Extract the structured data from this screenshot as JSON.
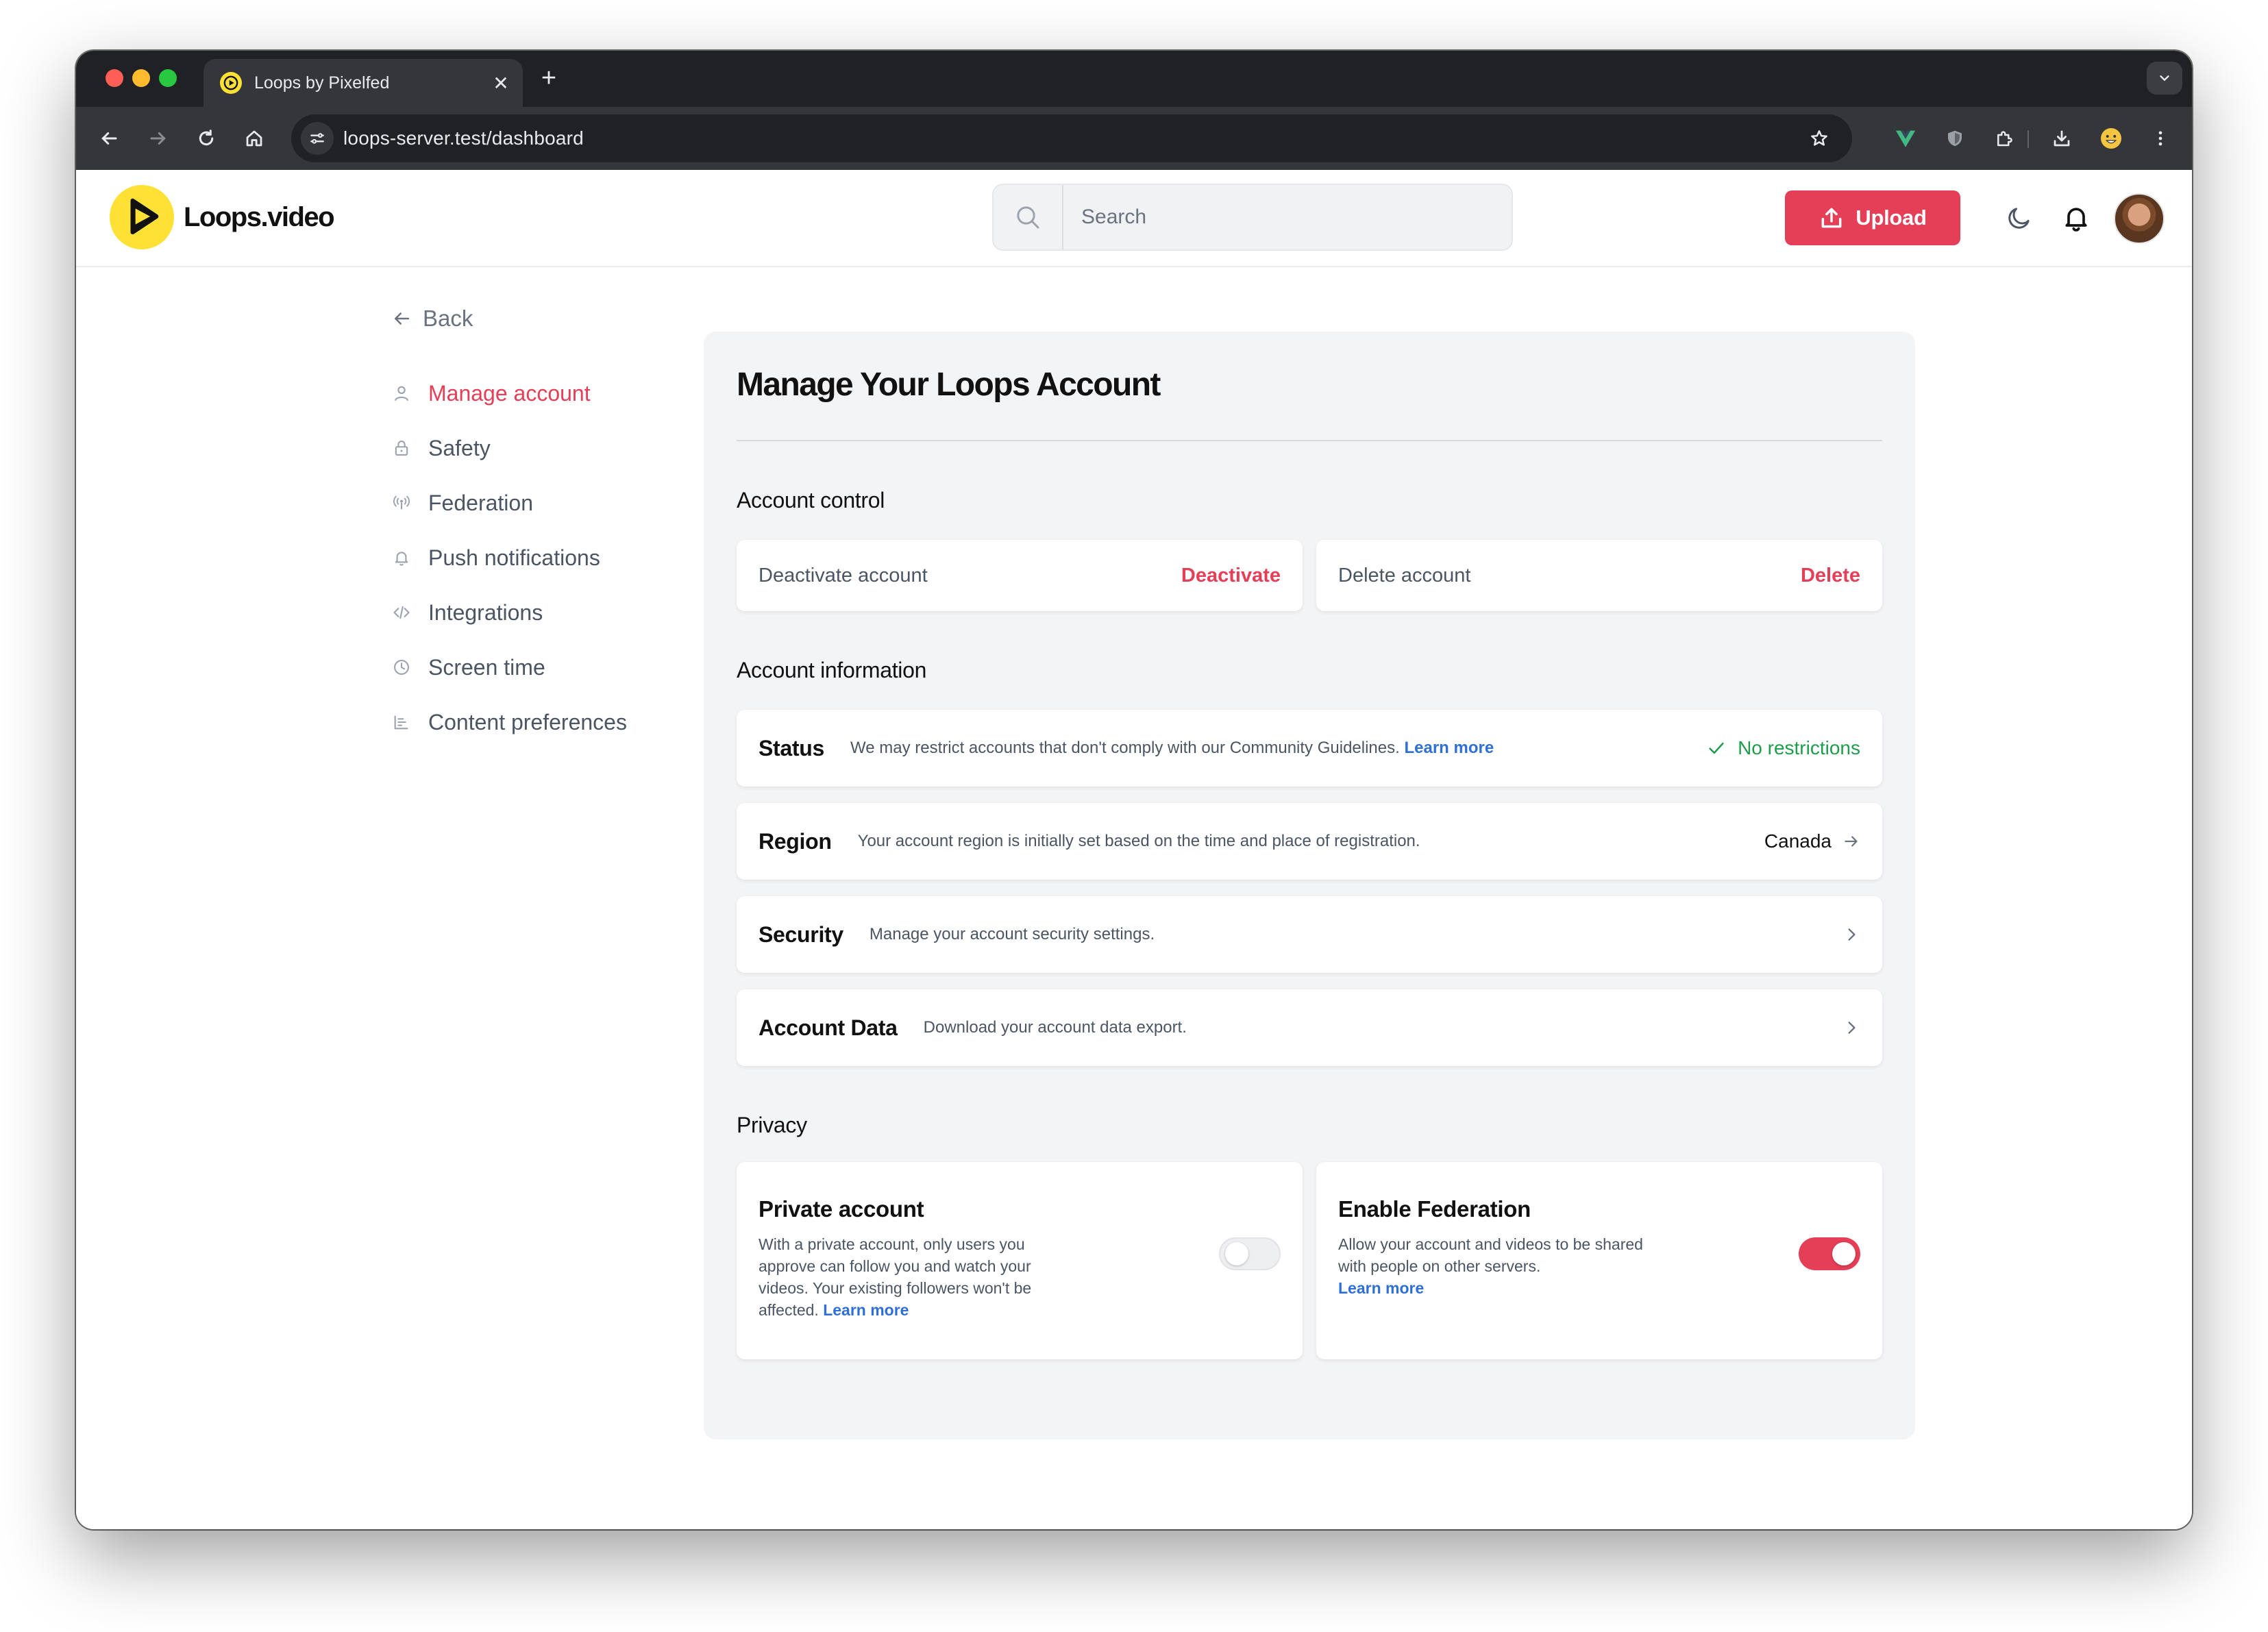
{
  "browser": {
    "tab_title": "Loops by Pixelfed",
    "url": "loops-server.test/dashboard"
  },
  "header": {
    "brand_name": "Loops.video",
    "search_placeholder": "Search",
    "upload_label": "Upload"
  },
  "sidebar": {
    "back_label": "Back",
    "items": [
      {
        "label": "Manage account",
        "icon": "user-icon",
        "active": true
      },
      {
        "label": "Safety",
        "icon": "lock-icon"
      },
      {
        "label": "Federation",
        "icon": "broadcast-icon"
      },
      {
        "label": "Push notifications",
        "icon": "bell-icon"
      },
      {
        "label": "Integrations",
        "icon": "code-icon"
      },
      {
        "label": "Screen time",
        "icon": "clock-icon"
      },
      {
        "label": "Content preferences",
        "icon": "sliders-icon"
      }
    ]
  },
  "main": {
    "title": "Manage Your Loops Account",
    "account_control": {
      "heading": "Account control",
      "deactivate_label": "Deactivate account",
      "deactivate_action": "Deactivate",
      "delete_label": "Delete account",
      "delete_action": "Delete"
    },
    "account_information": {
      "heading": "Account information",
      "status": {
        "name": "Status",
        "desc": "We may restrict accounts that don't comply with our Community Guidelines.",
        "link": "Learn more",
        "value": "No restrictions"
      },
      "region": {
        "name": "Region",
        "desc": "Your account region is initially set based on the time and place of registration.",
        "value": "Canada"
      },
      "security": {
        "name": "Security",
        "desc": "Manage your account security settings."
      },
      "account_data": {
        "name": "Account Data",
        "desc": "Download your account data export."
      }
    },
    "privacy": {
      "heading": "Privacy",
      "private_account": {
        "title": "Private account",
        "desc": "With a private account, only users you approve can follow you and watch your videos. Your existing followers won't be affected.",
        "link": "Learn more",
        "enabled": false
      },
      "federation": {
        "title": "Enable Federation",
        "desc": "Allow your account and videos to be shared with people on other servers.",
        "link": "Learn more",
        "enabled": true
      }
    }
  },
  "colors": {
    "accent": "#e53e57",
    "brand_yellow": "#ffe135",
    "link": "#2f6fd6",
    "success": "#1f9d4c"
  }
}
